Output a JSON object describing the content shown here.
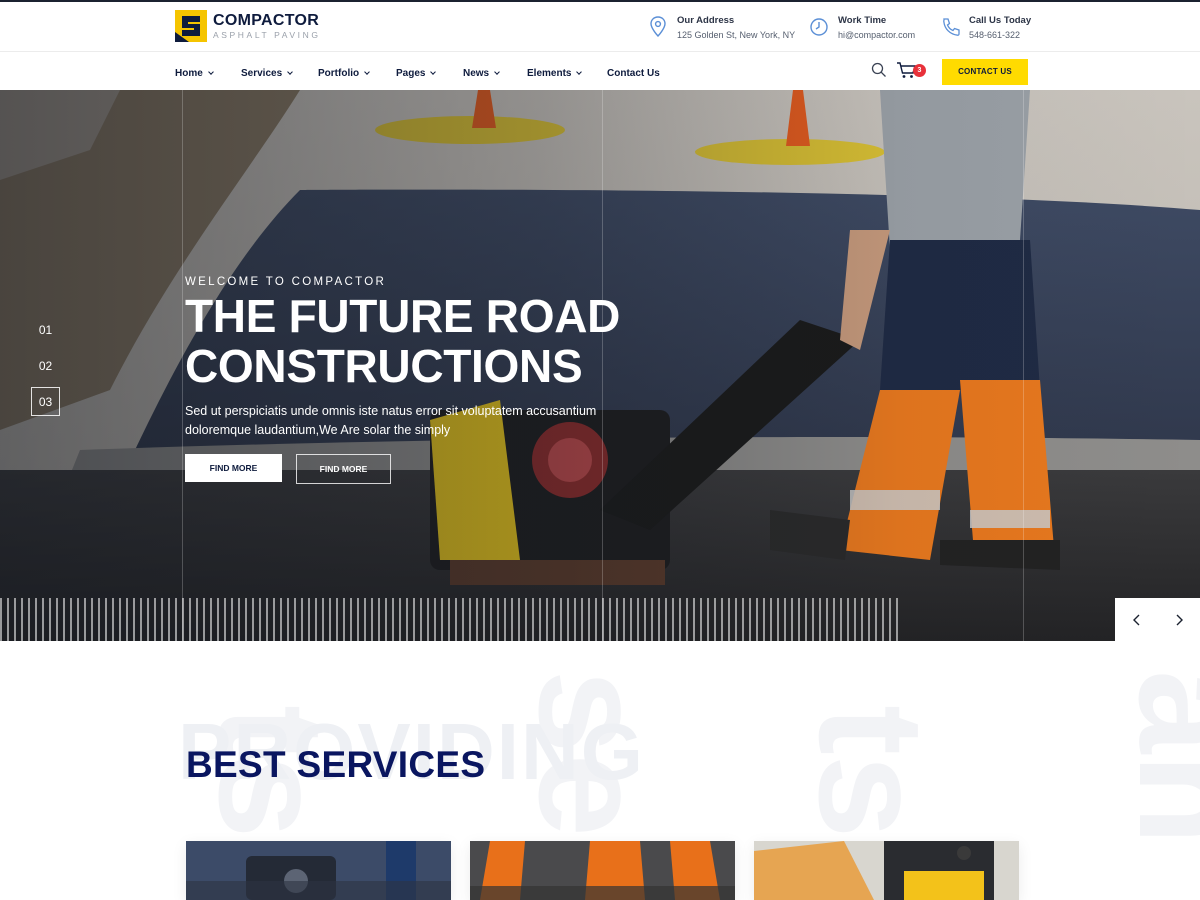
{
  "brand": {
    "name": "COMPACTOR",
    "tagline": "ASPHALT PAVING",
    "colors": {
      "accent": "#ffdb00",
      "navy": "#0a1660",
      "badge": "#e8313a"
    }
  },
  "header": {
    "address": {
      "icon": "map-pin-icon",
      "title": "Our Address",
      "value": "125 Golden St, New York, NY"
    },
    "work_time": {
      "icon": "clock-icon",
      "title": "Work Time",
      "value": "hi@compactor.com"
    },
    "phone": {
      "icon": "phone-icon",
      "title": "Call Us Today",
      "value": "548-661-322"
    }
  },
  "nav": {
    "items": [
      {
        "label": "Home"
      },
      {
        "label": "Services"
      },
      {
        "label": "Portfolio"
      },
      {
        "label": "Pages"
      },
      {
        "label": "News"
      },
      {
        "label": "Elements"
      },
      {
        "label": "Contact Us"
      }
    ],
    "cart_count": "3",
    "contact_button": "CONTACT US"
  },
  "hero": {
    "eyebrow": "WELCOME TO COMPACTOR",
    "headline_line1": "THE FUTURE ROAD",
    "headline_line2": "CONSTRUCTIONS",
    "description": "Sed ut perspiciatis unde omnis iste natus error sit voluptatem accusantium doloremque laudantium,We Are solar the simply",
    "button_primary": "FIND MORE",
    "button_secondary": "FIND MORE",
    "slides": [
      "01",
      "02",
      "03"
    ],
    "active_slide": "03"
  },
  "services": {
    "title_part1": "BEST",
    "title_part2": "SERVICES",
    "ghost_word": "PROVIDING"
  }
}
